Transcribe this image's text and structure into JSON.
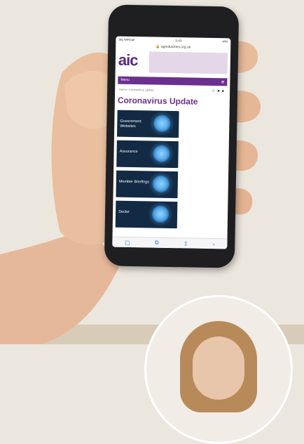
{
  "statusbar": {
    "carrier": "Sky WiFiCall",
    "time": "11:03",
    "battery": "94%"
  },
  "url": "agindustries.org.uk",
  "site": {
    "logo": "aic",
    "menu_label": "Menu",
    "breadcrumb": "Home / Coronavirus Update",
    "title": "Coronavirus Update"
  },
  "tiles": [
    {
      "label": "Government Websites"
    },
    {
      "label": "Assurance"
    },
    {
      "label": "Member Briefings"
    },
    {
      "label": "Sector"
    }
  ],
  "icons": {
    "menu": "hamburger-icon",
    "toolbar": [
      "tabs-icon",
      "book-icon",
      "share-icon",
      "forward-icon"
    ]
  }
}
